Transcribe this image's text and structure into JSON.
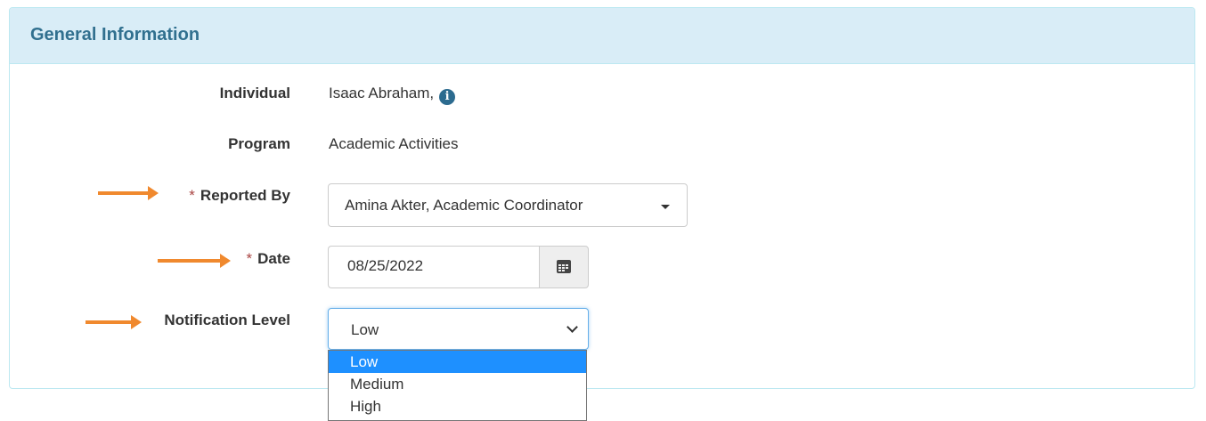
{
  "panel": {
    "title": "General Information"
  },
  "fields": {
    "individual": {
      "label": "Individual",
      "value": "Isaac Abraham,"
    },
    "program": {
      "label": "Program",
      "value": "Academic Activities"
    },
    "reported_by": {
      "required_marker": "*",
      "label": "Reported By",
      "value": "Amina Akter, Academic Coordinator"
    },
    "date": {
      "required_marker": "*",
      "label": "Date",
      "value": "08/25/2022"
    },
    "notification_level": {
      "label": "Notification Level",
      "value": "Low",
      "options": [
        "Low",
        "Medium",
        "High"
      ]
    }
  },
  "icons": {
    "info": "i"
  },
  "colors": {
    "heading_bg": "#d9edf7",
    "heading_text": "#31708f",
    "arrow": "#f0892e",
    "selected_option": "#1e90ff"
  }
}
